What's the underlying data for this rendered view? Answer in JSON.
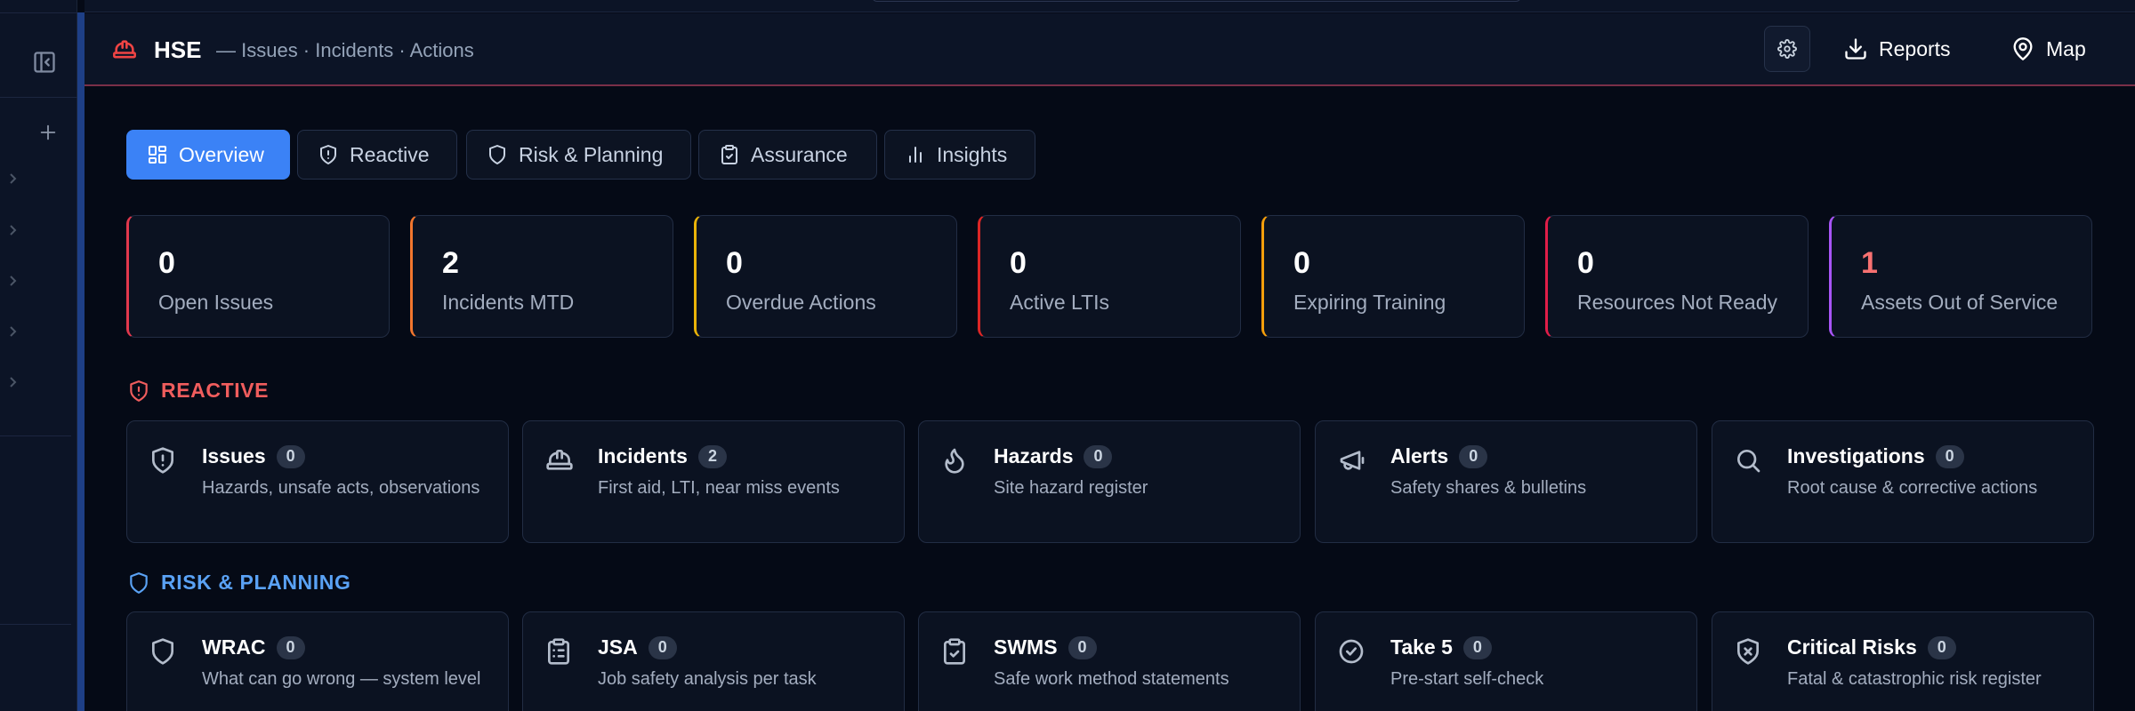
{
  "colors": {
    "accent": "#3b82f6",
    "danger": "#ef4444",
    "reactive": "#f05d5d",
    "risk_planning": "#5aa2f5",
    "assets_out_value": "#f87171"
  },
  "header": {
    "brand": "HSE",
    "subtitle": "— Issues · Incidents · Actions",
    "reports_label": "Reports",
    "map_label": "Map"
  },
  "tabs": [
    {
      "label": "Overview",
      "icon": "dashboard-icon",
      "active": true
    },
    {
      "label": "Reactive",
      "icon": "shield-alert-icon",
      "active": false
    },
    {
      "label": "Risk & Planning",
      "icon": "shield-icon",
      "active": false
    },
    {
      "label": "Assurance",
      "icon": "clipboard-check-icon",
      "active": false
    },
    {
      "label": "Insights",
      "icon": "bar-chart-icon",
      "active": false
    }
  ],
  "stats": [
    {
      "value": "0",
      "label": "Open Issues",
      "accent": "#e2384d"
    },
    {
      "value": "2",
      "label": "Incidents MTD",
      "accent": "#f2762e"
    },
    {
      "value": "0",
      "label": "Overdue Actions",
      "accent": "#eab308"
    },
    {
      "value": "0",
      "label": "Active LTIs",
      "accent": "#dc2626"
    },
    {
      "value": "0",
      "label": "Expiring Training",
      "accent": "#f59e0b"
    },
    {
      "value": "0",
      "label": "Resources Not Ready",
      "accent": "#e11d48"
    },
    {
      "value": "1",
      "label": "Assets Out of Service",
      "accent": "#a855f7"
    }
  ],
  "sections": {
    "reactive": {
      "title": "REACTIVE",
      "cards": [
        {
          "title": "Issues",
          "count": "0",
          "desc": "Hazards, unsafe acts, observations",
          "icon": "shield-alert-icon"
        },
        {
          "title": "Incidents",
          "count": "2",
          "desc": "First aid, LTI, near miss events",
          "icon": "hard-hat-icon"
        },
        {
          "title": "Hazards",
          "count": "0",
          "desc": "Site hazard register",
          "icon": "flame-icon"
        },
        {
          "title": "Alerts",
          "count": "0",
          "desc": "Safety shares & bulletins",
          "icon": "megaphone-icon"
        },
        {
          "title": "Investigations",
          "count": "0",
          "desc": "Root cause & corrective actions",
          "icon": "search-icon"
        }
      ]
    },
    "risk_planning": {
      "title": "RISK & PLANNING",
      "cards": [
        {
          "title": "WRAC",
          "count": "0",
          "desc": "What can go wrong — system level",
          "icon": "shield-icon"
        },
        {
          "title": "JSA",
          "count": "0",
          "desc": "Job safety analysis per task",
          "icon": "clipboard-list-icon"
        },
        {
          "title": "SWMS",
          "count": "0",
          "desc": "Safe work method statements",
          "icon": "clipboard-check-icon"
        },
        {
          "title": "Take 5",
          "count": "0",
          "desc": "Pre-start self-check",
          "icon": "check-circle-icon"
        },
        {
          "title": "Critical Risks",
          "count": "0",
          "desc": "Fatal & catastrophic risk register",
          "icon": "shield-x-icon"
        }
      ]
    }
  }
}
